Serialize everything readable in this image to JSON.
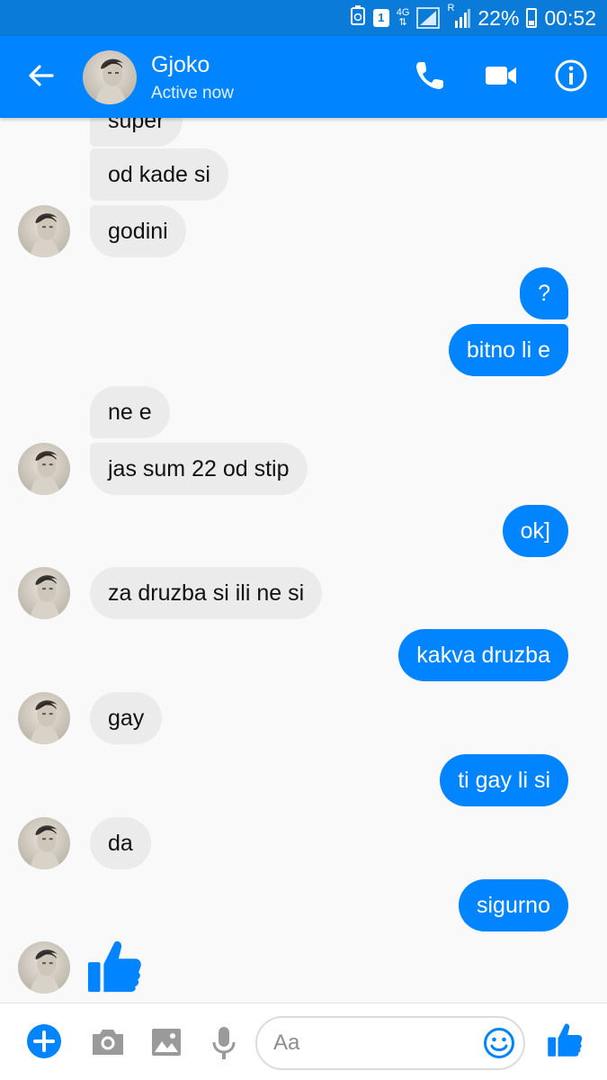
{
  "status_bar": {
    "network": "4G",
    "sim_badge": "1",
    "roaming": "R",
    "battery": "22%",
    "time": "00:52"
  },
  "header": {
    "contact_name": "Gjoko",
    "contact_status": "Active now",
    "icons": [
      "back-arrow-icon",
      "phone-icon",
      "video-camera-icon",
      "info-icon"
    ]
  },
  "messages": [
    {
      "from": "contact",
      "text": "super"
    },
    {
      "from": "contact",
      "text": "od kade si"
    },
    {
      "from": "contact",
      "text": "godini"
    },
    {
      "from": "me",
      "text": "?"
    },
    {
      "from": "me",
      "text": "bitno li e"
    },
    {
      "from": "contact",
      "text": "ne e"
    },
    {
      "from": "contact",
      "text": "jas sum 22 od stip"
    },
    {
      "from": "me",
      "text": "ok]"
    },
    {
      "from": "contact",
      "text": "za druzba si ili ne si"
    },
    {
      "from": "me",
      "text": "kakva druzba"
    },
    {
      "from": "contact",
      "text": "gay"
    },
    {
      "from": "me",
      "text": "ti gay li si"
    },
    {
      "from": "contact",
      "text": "da"
    },
    {
      "from": "me",
      "text": "sigurno"
    },
    {
      "from": "contact",
      "sticker": "thumbs-up-icon"
    }
  ],
  "composer": {
    "placeholder": "Aa",
    "icons": [
      "plus-icon",
      "camera-icon",
      "gallery-icon",
      "microphone-icon",
      "emoji-icon",
      "thumbs-up-icon"
    ]
  },
  "colors": {
    "status_bar": "#0a7bd9",
    "header": "#0084ff",
    "outgoing_bubble": "#0084ff",
    "incoming_bubble": "#ebebeb",
    "background": "#f9f9f9"
  }
}
